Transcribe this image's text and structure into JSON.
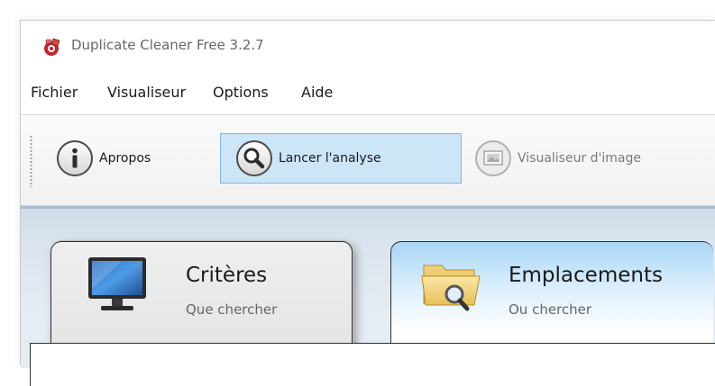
{
  "window": {
    "title": "Duplicate Cleaner Free 3.2.7",
    "app_icon": "duplicate-cleaner-logo-icon"
  },
  "menu": {
    "items": [
      {
        "label": "Fichier"
      },
      {
        "label": "Visualiseur"
      },
      {
        "label": "Options"
      },
      {
        "label": "Aide"
      }
    ]
  },
  "toolbar": {
    "buttons": [
      {
        "label": "Apropos",
        "icon": "info-icon",
        "state": "normal"
      },
      {
        "label": "Lancer l'analyse",
        "icon": "magnifier-icon",
        "state": "selected"
      },
      {
        "label": "Visualiseur d'image",
        "icon": "image-viewer-icon",
        "state": "disabled"
      }
    ]
  },
  "tabs": [
    {
      "title": "Critères",
      "subtitle": "Que chercher",
      "icon": "monitor-icon",
      "active": false
    },
    {
      "title": "Emplacements",
      "subtitle": "Ou chercher",
      "icon": "folder-search-icon",
      "active": true
    }
  ],
  "colors": {
    "selection_fill": "#cde6f7",
    "selection_border": "#7eb4ea",
    "active_tab_top": "#a9d6f7",
    "content_background": "#dbe4ee"
  }
}
